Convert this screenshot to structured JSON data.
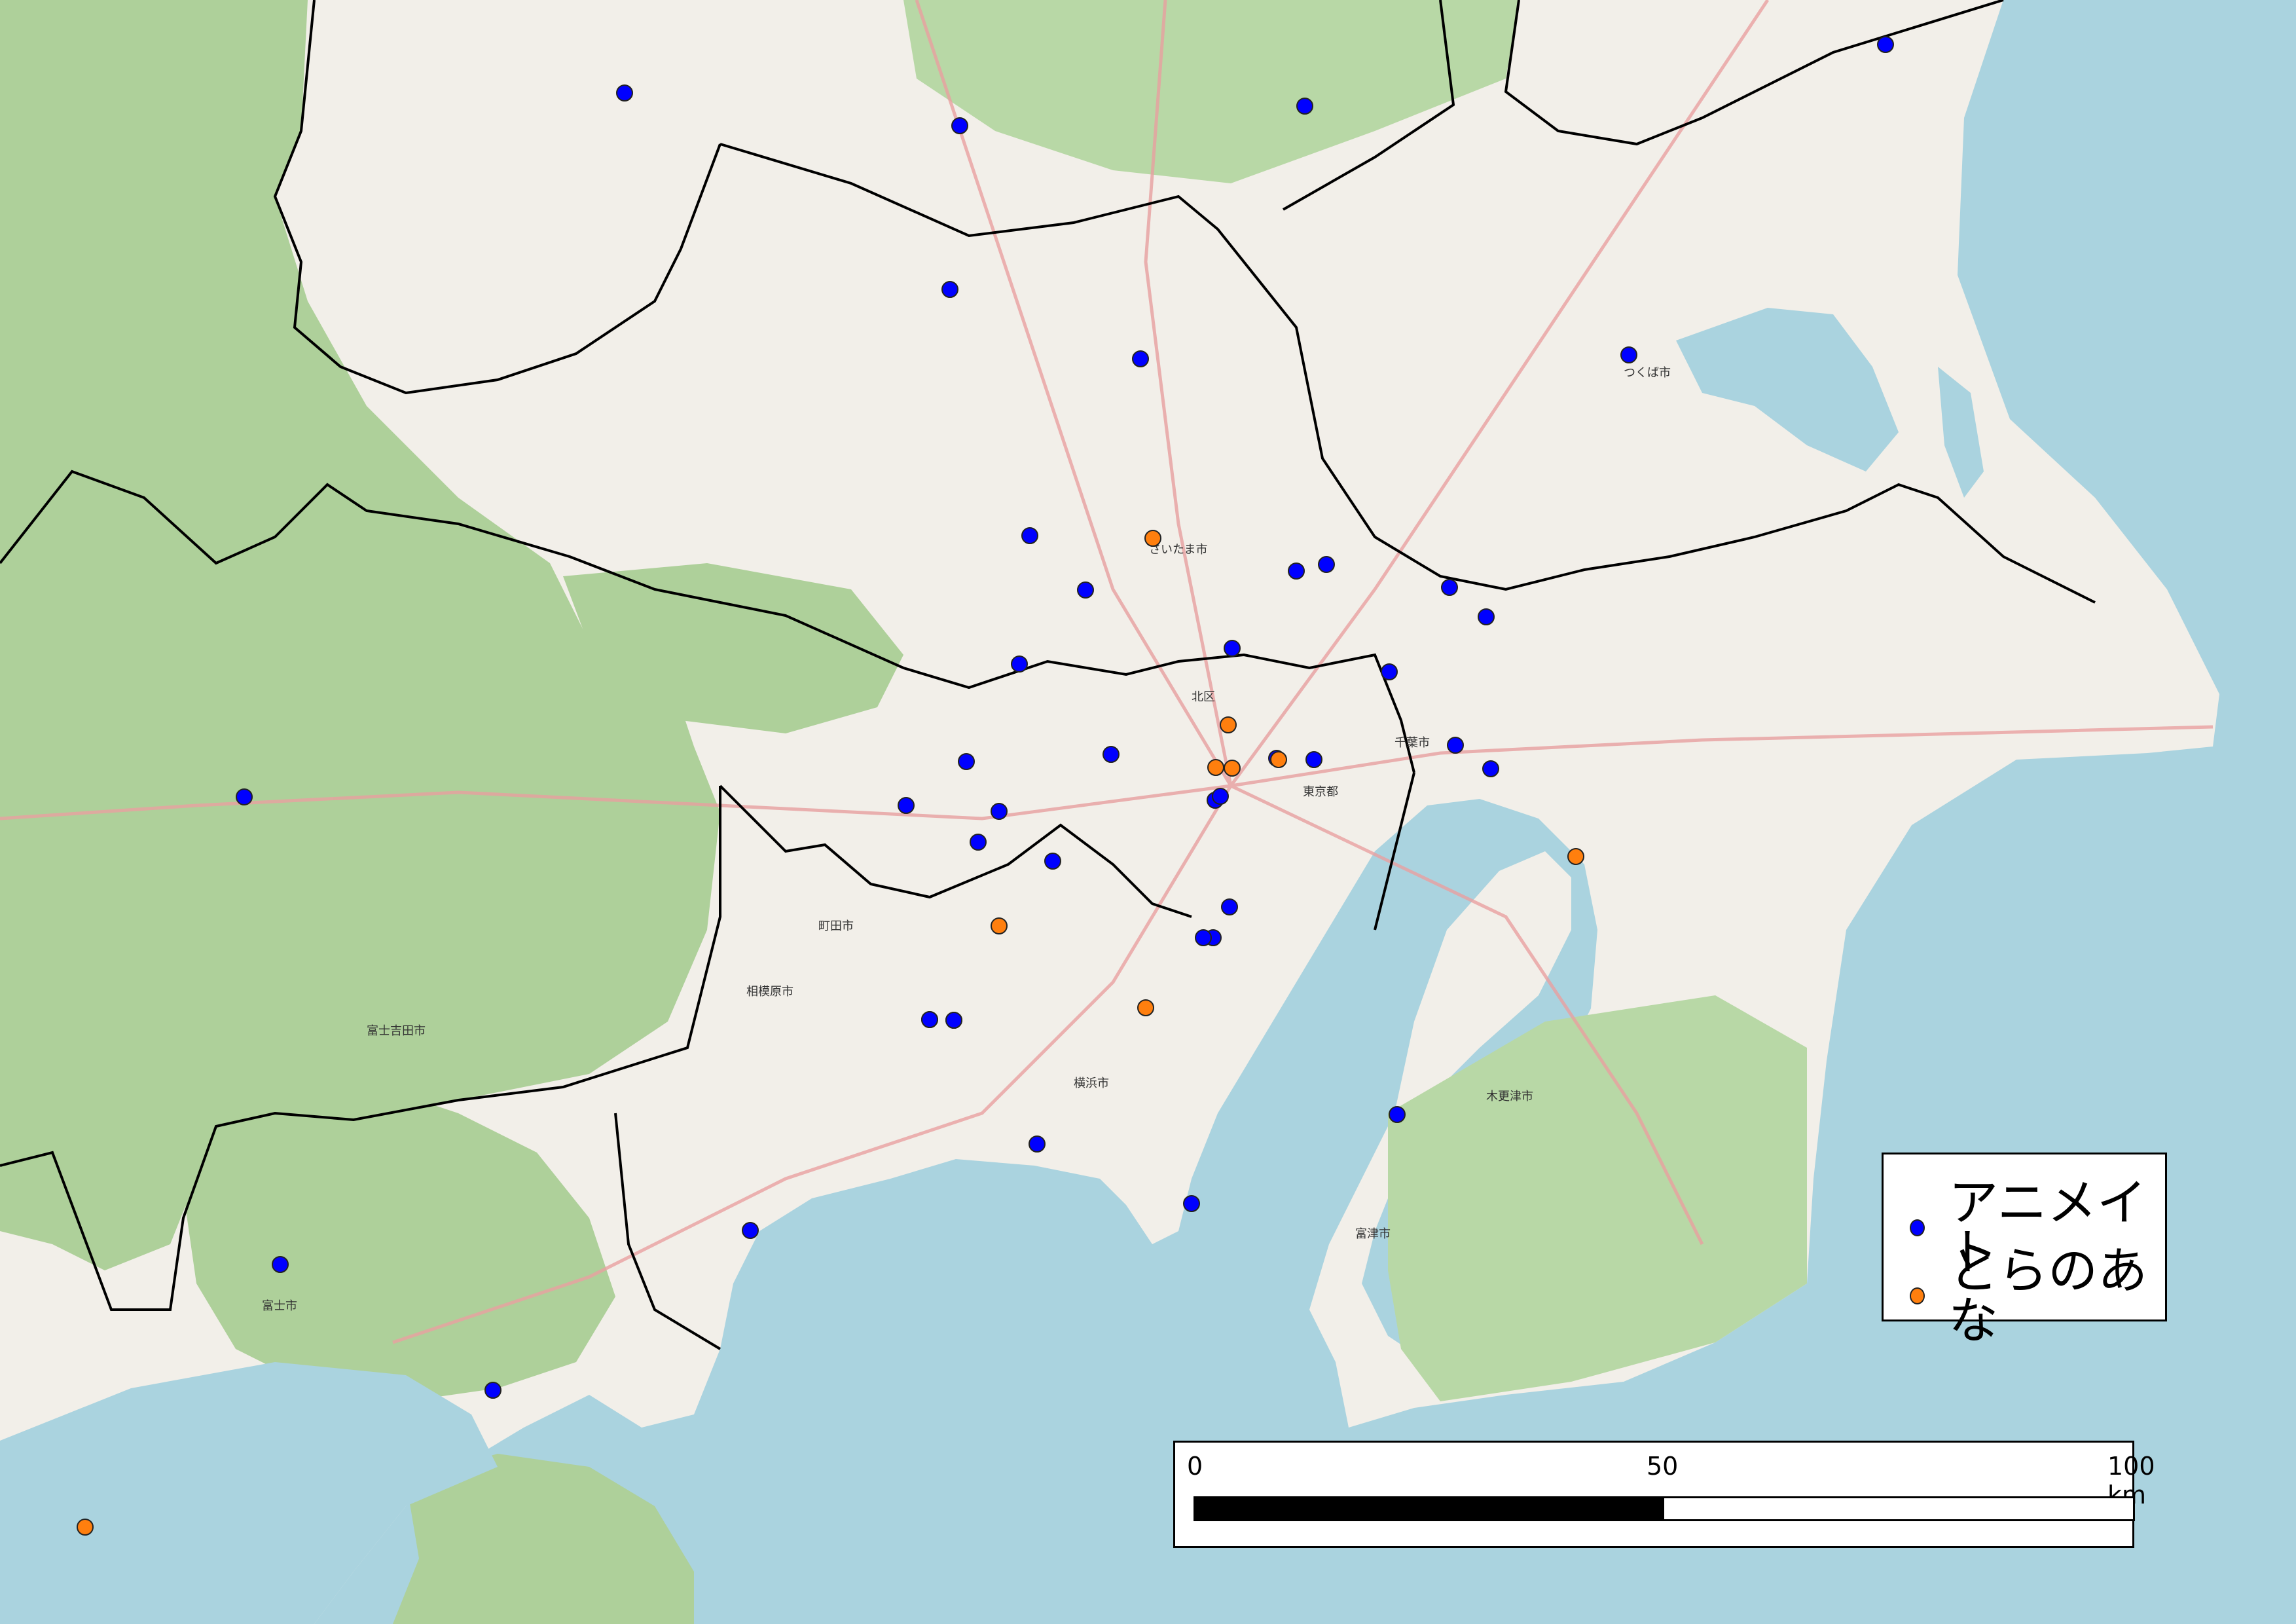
{
  "legend": {
    "items": [
      {
        "label": "アニメイト",
        "color": "#0000ff"
      },
      {
        "label": "とらのあな",
        "color": "#ff7f0e"
      }
    ]
  },
  "scalebar": {
    "labels": [
      "0",
      "50",
      "100 km"
    ],
    "max_km": 100,
    "split_km": 50
  },
  "colors": {
    "sea": "#aad3df",
    "land": "#f2efe9",
    "forest": "#aed09a",
    "border": "#000000"
  },
  "stores": {
    "animate_count": 42,
    "toranoana_count": 9
  }
}
